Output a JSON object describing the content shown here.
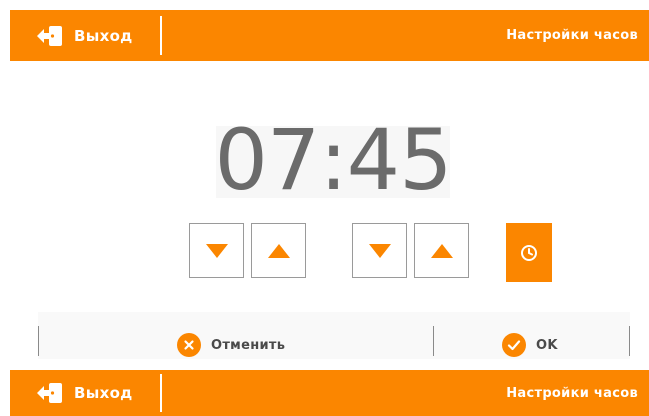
{
  "header": {
    "exit_label": "Выход",
    "title": "Настройки часов"
  },
  "clock": {
    "time": "07:45"
  },
  "actions": {
    "cancel_label": "Отменить",
    "ok_label": "OK"
  },
  "footer": {
    "exit_label": "Выход",
    "title": "Настройки часов"
  },
  "icons": {
    "exit": "exit-door-icon",
    "hour_down": "triangle-down-icon",
    "hour_up": "triangle-up-icon",
    "minute_down": "triangle-down-icon",
    "minute_up": "triangle-up-icon",
    "clock": "clock-icon",
    "cancel": "close-circle-icon",
    "ok": "check-circle-icon"
  },
  "colors": {
    "accent": "#fb8600",
    "text_gray": "#6b6b6b"
  }
}
